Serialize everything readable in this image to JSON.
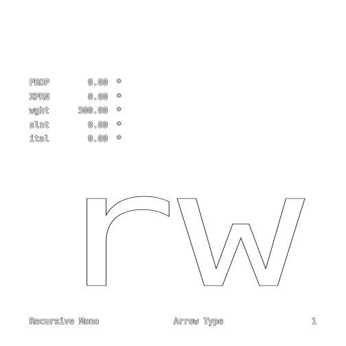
{
  "axes": [
    {
      "tag": "PROP",
      "value": "0.00",
      "mark": "*"
    },
    {
      "tag": "XPRN",
      "value": "0.00",
      "mark": "*"
    },
    {
      "tag": "wght",
      "value": "300.00",
      "mark": "*"
    },
    {
      "tag": "slnt",
      "value": "0.00",
      "mark": "*"
    },
    {
      "tag": "ital",
      "value": "0.00",
      "mark": "*"
    }
  ],
  "specimen": {
    "text": "rw"
  },
  "footer": {
    "font_name": "Recursive Mono",
    "foundry": "Arrow Type",
    "page_number": "1"
  },
  "colors": {
    "background": "#ffffff",
    "outline": "#555555",
    "fill": "#ffffff"
  }
}
